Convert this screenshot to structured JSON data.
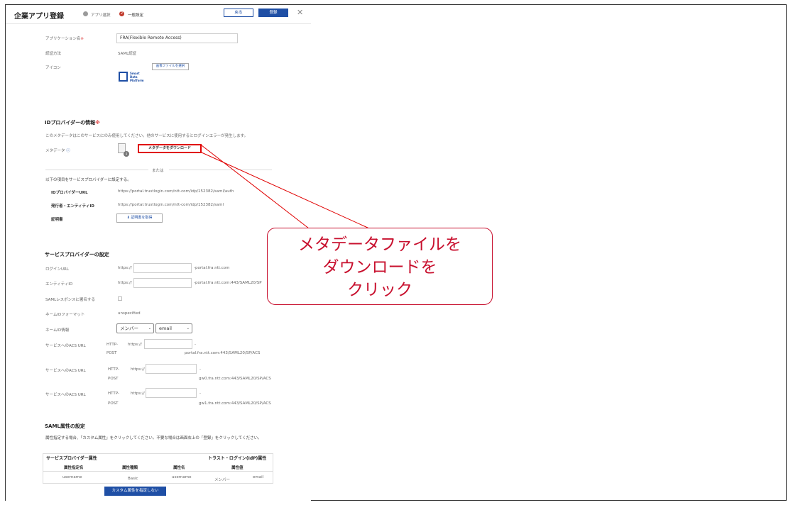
{
  "header": {
    "title": "企業アプリ登録",
    "steps": [
      "アプリ選択",
      "一般設定"
    ],
    "step_number": "2",
    "back_label": "戻る",
    "submit_label": "登録",
    "close_icon": "close-icon"
  },
  "app": {
    "name_label": "アプリケーション名",
    "name_value": "FRA(Flexible Remote Access)",
    "auth_label": "認証方法",
    "auth_value": "SAML認証",
    "icon_label": "アイコン",
    "select_image_label": "画像ファイルを選択",
    "logo_lines": [
      "Smart",
      "Data",
      "Platform"
    ]
  },
  "idp": {
    "heading": "IDプロバイダーの情報",
    "note": "このメタデータはこのサービスにのみ使用してください。他のサービスに使用するとログインエラーが発生します。",
    "metadata_label": "メタデータ",
    "download_label": "メタデータをダウンロード",
    "or_label": "または",
    "manual_note": "以下の項目をサービスプロバイダーに設定する。",
    "url_label": "IDプロバイダーURL",
    "url_value": "https://portal.trustlogin.com/ntt-com/idp/152382/saml/auth",
    "issuer_label": "発行者・エンティティID",
    "issuer_value": "https://portal.trustlogin.com/ntt-com/idp/152382/saml",
    "cert_label": "証明書",
    "cert_button": "証明書を取得"
  },
  "sp": {
    "heading": "サービスプロバイダーの設定",
    "login_url_label": "ログインURL",
    "login_prefix": "https://",
    "login_suffix": "-portal.fra.ntt.com",
    "entity_label": "エンティティID",
    "entity_prefix": "https://",
    "entity_suffix": "-portal.fra.ntt.com:443/SAML20/SP",
    "sign_label": "SAMLレスポンスに署名する",
    "nameid_format_label": "ネームIDフォーマット",
    "nameid_format_value": "unspecified",
    "nameid_attr_label": "ネームID情報",
    "nameid_select1": "メンバー",
    "nameid_select2": "email",
    "acs": [
      {
        "label": "サービスへのACS URL",
        "method1": "HTTP-",
        "method2": "POST",
        "prefix": "https://",
        "suffix1": "-",
        "suffix2": "portal.fra.ntt.com:443/SAML20/SP/ACS"
      },
      {
        "label": "サービスへのACS URL",
        "method1": "HTTP-",
        "method2": "POST",
        "prefix": "https://",
        "suffix1": "-",
        "suffix2": "gw0.fra.ntt.com:443/SAML20/SP/ACS"
      },
      {
        "label": "サービスへのACS URL",
        "method1": "HTTP-",
        "method2": "POST",
        "prefix": "https://",
        "suffix1": "-",
        "suffix2": "gw1.fra.ntt.com:443/SAML20/SP/ACS"
      }
    ]
  },
  "saml_attr": {
    "heading": "SAML属性の設定",
    "note": "属性指定する場合、「カスタム属性」をクリックしてください。不要な場合は画面右上の「登録」をクリックしてください。",
    "sp_attr_label": "サービスプロバイダー属性",
    "idp_attr_label": "トラスト・ログイン(IdP)属性",
    "columns": [
      "属性指定名",
      "属性種類",
      "属性名",
      "属性値"
    ],
    "row": [
      "username",
      "Basic",
      "username",
      "メンバー",
      "email"
    ],
    "custom_button": "カスタム属性を指定しない"
  },
  "callout": {
    "lines": [
      "メタデータファイルを",
      "ダウンロードを",
      "クリック"
    ]
  }
}
